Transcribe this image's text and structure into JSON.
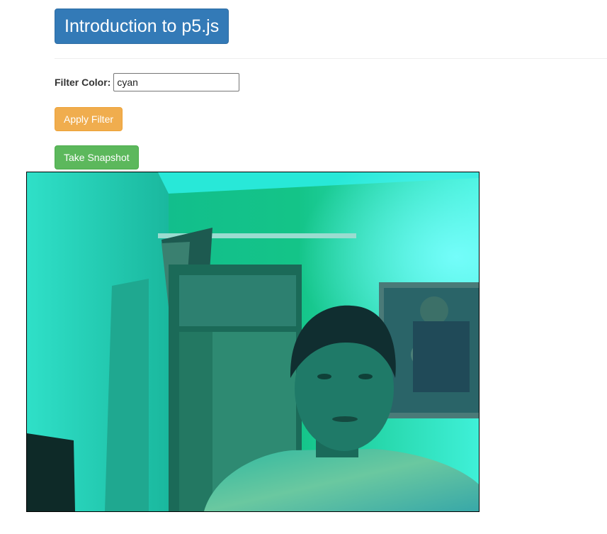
{
  "header": {
    "title": "Introduction to p5.js"
  },
  "filter": {
    "label": "Filter Color:",
    "value": "cyan"
  },
  "buttons": {
    "apply_filter": "Apply Filter",
    "take_snapshot": "Take Snapshot"
  },
  "colors": {
    "title_bg": "#337ab7",
    "apply_button_bg": "#f0ad4e",
    "snapshot_button_bg": "#5cb85c",
    "video_tint": "#00e5cc"
  }
}
